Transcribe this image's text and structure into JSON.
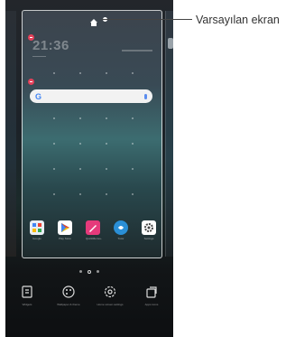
{
  "callout": {
    "text": "Varsayılan ekran"
  },
  "home_screen": {
    "clock": "21:36",
    "search_logo": "G"
  },
  "dock_apps": [
    {
      "name": "Google",
      "icon": "folder-icon",
      "color": "#e8eef5"
    },
    {
      "name": "Play Store",
      "icon": "play-store-icon",
      "color": "#ffffff"
    },
    {
      "name": "QuickMemo+",
      "icon": "pen-icon",
      "color": "#e53a7b"
    },
    {
      "name": "Tutor",
      "icon": "chat-icon",
      "color": "#2a8fd6"
    },
    {
      "name": "Settings",
      "icon": "gear-icon",
      "color": "#ffffff"
    }
  ],
  "bottom_options": [
    {
      "label": "Widgets",
      "icon": "widget-icon"
    },
    {
      "label": "Wallpaper & theme",
      "icon": "palette-icon"
    },
    {
      "label": "Home screen settings",
      "icon": "gear-icon"
    },
    {
      "label": "Apps icons",
      "icon": "copy-icon"
    }
  ]
}
